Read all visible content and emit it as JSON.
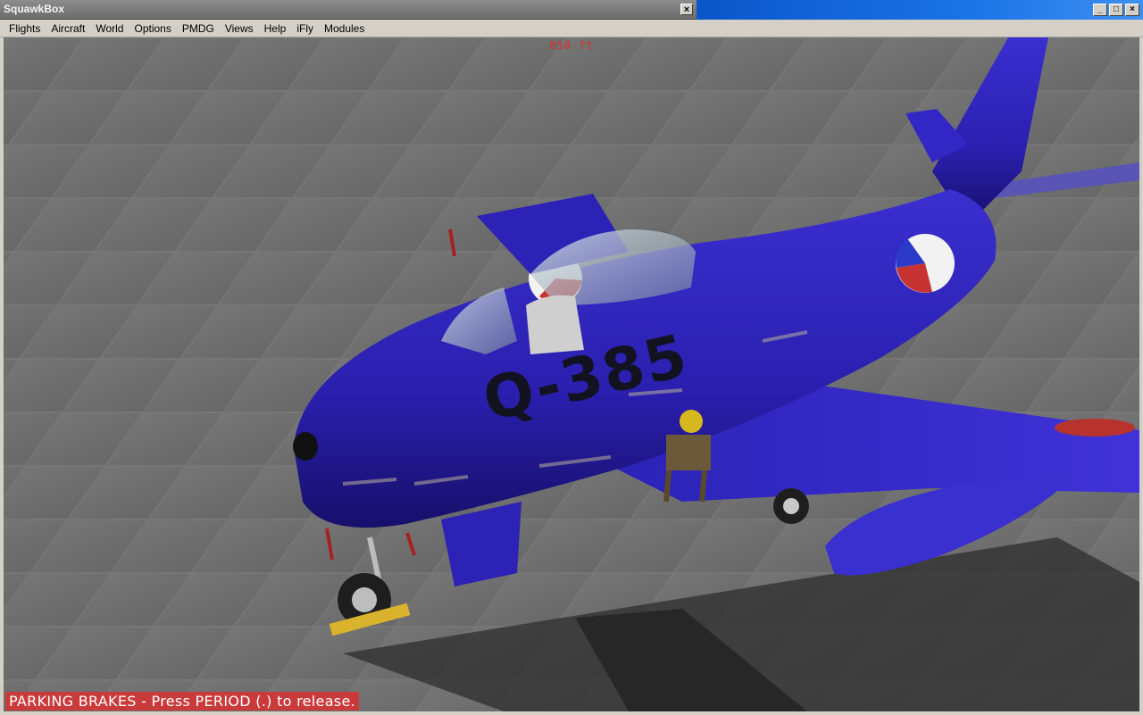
{
  "squawkbox": {
    "title": "SquawkBox",
    "close_glyph": "×"
  },
  "window": {
    "min_glyph": "_",
    "max_glyph": "□",
    "close_glyph": "×"
  },
  "menu": {
    "items": [
      "Flights",
      "Aircraft",
      "World",
      "Options",
      "PMDG",
      "Views",
      "Help",
      "iFly",
      "Modules"
    ]
  },
  "hud": {
    "altitude": "850 ft",
    "status_message": "PARKING BRAKES - Press PERIOD (.) to release."
  },
  "aircraft": {
    "registration": "Q-385"
  },
  "colors": {
    "titlebar_blue": "#0b56c8",
    "hud_red": "#e22a2a",
    "status_bg": "#c93a3a",
    "aircraft_blue": "#2b1fb0",
    "tarmac": "#6f6f6f"
  }
}
